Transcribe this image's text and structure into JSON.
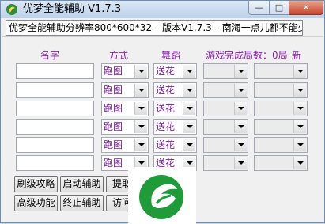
{
  "window": {
    "title": "优梦全能辅助 V1.7.3",
    "info_text": "优梦全能辅助分辨率800*600*32---版本V1.7.3---南海一点儿都不能少",
    "controls": {
      "minimize": "—",
      "maximize": "□",
      "close": "✕"
    }
  },
  "headers": {
    "name": "名字",
    "mode": "方式",
    "dance": "舞蹈",
    "games_done": "游戏完成局数：0局",
    "refresh": "新"
  },
  "rows": [
    {
      "mode": "跑图",
      "dance": "送花"
    },
    {
      "mode": "跑图",
      "dance": "送花"
    },
    {
      "mode": "跑图",
      "dance": "送花"
    },
    {
      "mode": "跑图",
      "dance": "送花"
    },
    {
      "mode": "跑图",
      "dance": "送花"
    },
    {
      "mode": "跑图",
      "dance": "送花"
    }
  ],
  "buttons": {
    "brush_guide": "刷级攻略",
    "start_assist": "启动辅助",
    "get_card": "提取",
    "advanced": "高级功能",
    "stop_assist": "终止辅助",
    "visit": "访问"
  },
  "colors": {
    "header_purple": "#8a1fb2",
    "value_purple": "#7b1fa2",
    "logo_green": "#1f9b3a"
  },
  "icons": {
    "app": "app-logo-icon",
    "overlay": "green-leaf-logo-icon"
  }
}
